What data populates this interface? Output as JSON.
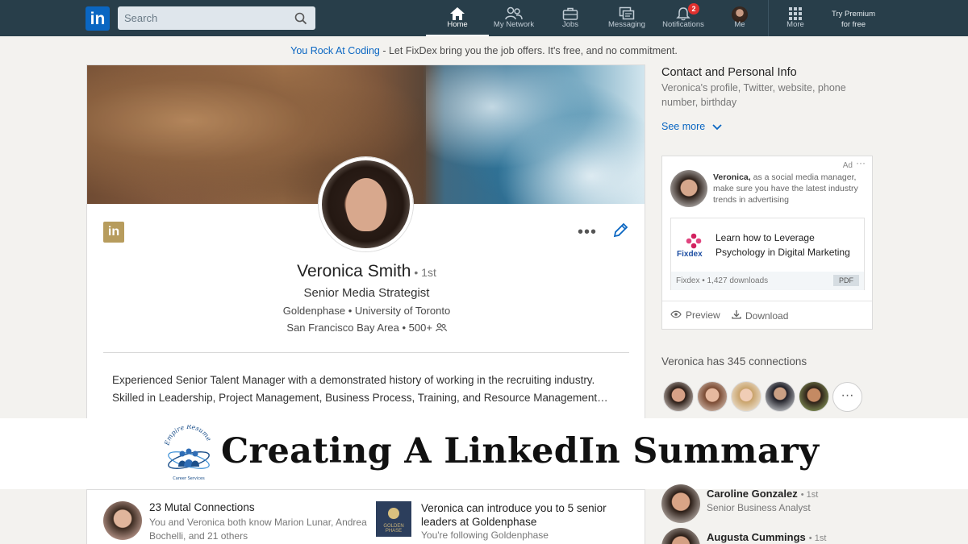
{
  "nav": {
    "logo": "in",
    "search_placeholder": "Search",
    "items": [
      {
        "label": "Home"
      },
      {
        "label": "My Network"
      },
      {
        "label": "Jobs"
      },
      {
        "label": "Messaging"
      },
      {
        "label": "Notifications",
        "badge": "2"
      },
      {
        "label": "Me"
      },
      {
        "label": "More"
      }
    ],
    "premium_line1": "Try Premium",
    "premium_line2": "for free"
  },
  "promo": {
    "link": "You Rock At Coding",
    "text": " - Let FixDex bring you the job offers. It's free, and no commitment."
  },
  "profile": {
    "badge": "in",
    "name": "Veronica Smith",
    "degree": "• 1st",
    "headline": "Senior Media Strategist",
    "company": "Goldenphase",
    "school": "University of Toronto",
    "location": "San Francisco Bay Area",
    "connections": "500+",
    "summary_line1": "Experienced Senior Talent Manager with a demonstrated history of working in the recruiting industry.",
    "summary_line2": "Skilled in Leadership, Project Management, Business Process, Training, and Resource Management…"
  },
  "banner": {
    "title": "Creating A LinkedIn Summary",
    "logo_text_top": "Empire Resume",
    "logo_text_bottom": "Career Services"
  },
  "highlights": {
    "mutual_title": "23 Mutal Connections",
    "mutual_sub": "You and Veronica both know Marion Lunar, Andrea Bochelli, and 21 others",
    "company_logo_text": "GOLDEN PHASE",
    "intro_title": "Veronica can introduce you to 5 senior leaders at Goldenphase",
    "intro_sub": "You're following Goldenphase"
  },
  "sidebar": {
    "contact_title": "Contact and Personal Info",
    "contact_desc": "Veronica's profile, Twitter, website, phone number, birthday",
    "see_more": "See more",
    "ad": {
      "label": "Ad",
      "more": "···",
      "sender": "Veronica,",
      "message": " as a social media manager, make sure you have the latest industry trends in advertising",
      "brand": "Fixdex",
      "headline": "Learn how to Leverage Psychology in Digital Marketing",
      "meta": "Fixdex • 1,427 downloads",
      "file_type": "PDF",
      "preview": "Preview",
      "download": "Download"
    },
    "connections_title": "Veronica has 345 connections",
    "connections_more": "···",
    "people": [
      {
        "name": "Caroline Gonzalez",
        "degree": "• 1st",
        "title": "Senior Business Analyst"
      },
      {
        "name": "Augusta Cummings",
        "degree": "• 1st",
        "title": ""
      }
    ]
  },
  "colors": {
    "nav_bg": "#283e4a",
    "brand_blue": "#0a66c2",
    "badge_red": "#e0302e",
    "page_bg": "#f3f2ef"
  }
}
